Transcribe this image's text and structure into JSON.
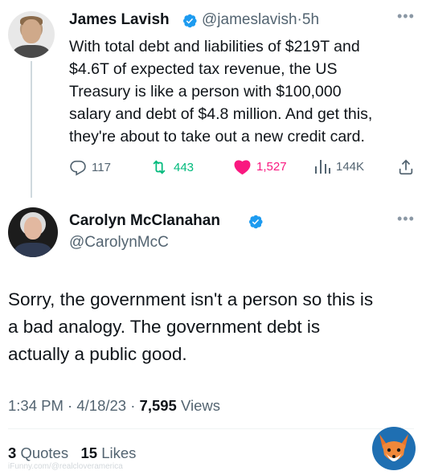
{
  "tweet1": {
    "author_name": "James Lavish",
    "handle": "@jameslavish",
    "separator": "·",
    "time": "5h",
    "text": "With total debt and liabilities of $219T and\n$4.6T of expected tax revenue, the US\nTreasury is like a person with $100,000\nsalary and debt of $4.8 million. And get this,\nthey're about to take out a new credit card.",
    "replies": "117",
    "retweets": "443",
    "likes": "1,527",
    "views": "144K"
  },
  "tweet2": {
    "author_name": "Carolyn McClanahan",
    "handle": "@CarolynMcC",
    "text": "Sorry, the government isn't a person so this is\na bad analogy. The government debt is\nactually a public good.",
    "time": "1:34 PM",
    "date": "4/18/23",
    "views_count": "7,595",
    "views_label": "Views",
    "quotes_count": "3",
    "quotes_label": "Quotes",
    "likes_count": "15",
    "likes_label": "Likes"
  },
  "watermark": "iFunny.com/@realcloveramerica",
  "colors": {
    "verified_blue": "#1d9bf0",
    "retweet_green": "#00ba7c",
    "like_pink": "#f91880",
    "secondary_text": "#536471"
  },
  "icons": [
    "more-icon",
    "verified-badge-icon",
    "reply-icon",
    "retweet-icon",
    "like-icon",
    "views-icon",
    "share-icon",
    "fox-logo-icon"
  ]
}
